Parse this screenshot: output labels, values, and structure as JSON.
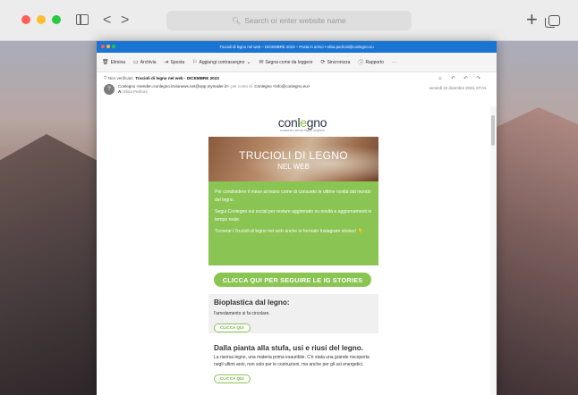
{
  "browser": {
    "address_placeholder": "Search or enter website name"
  },
  "outlook": {
    "window_title": "Trucioli di legno nel web – DICEMBRE 2023 – Posta in arrivo • elisa.pedroni@conlegno.eu",
    "toolbar": [
      {
        "icon": "trash-icon",
        "label": "Elimina"
      },
      {
        "icon": "archive-icon",
        "label": "Archivia"
      },
      {
        "icon": "move-icon",
        "label": "Sposta"
      },
      {
        "icon": "flag-icon",
        "label": "Aggiungi contrassegno"
      },
      {
        "icon": "envelope-icon",
        "label": "Segna come da leggere"
      },
      {
        "icon": "sync-icon",
        "label": "Sincronizza"
      },
      {
        "icon": "info-icon",
        "label": "Rapporto"
      }
    ],
    "toolbar_more": "···",
    "header": {
      "unverified_label": "Non verificato",
      "subject": "Trucioli di legno nel web - DICEMBRE 2023",
      "avatar_letter": "?",
      "sender": "Conlegno <sender=conlegno.invionews.net@opp.mymailer.it>",
      "on_behalf": "per conto di",
      "sender_alias": "Conlegno <info@conlegno.eu>",
      "to_label": "A:",
      "recipient": "Elisa Pedroni",
      "date": "venerdì 22 dicembre 2023, 07:04",
      "actions": "☺ ↶ ↶ ↷"
    }
  },
  "newsletter": {
    "logo_main": "conl",
    "logo_o": "e",
    "logo_rest": "gno",
    "logo_sub": "consorzio servizi legno sughero",
    "hero_line1": "TRUCIOLI DI LEGNO",
    "hero_line2": "NEL WEB",
    "intro_p1": "Per condividere il mese arrivano come di consueto le ultime novità dal mondo del legno.",
    "intro_p2": "Segui Conlegno sui social per restare aggiornato su novità e aggiornamenti in tempo reale.",
    "intro_p3": "Troverai i Trucioli di legno nel web anche in formato Instagram stories!",
    "intro_emoji": "👇",
    "cta_ig": "CLICCA QUI PER SEGUIRE LE IG STORIES",
    "article1_title": "Bioplastica dal legno:",
    "article1_text": "l'arredamento si fa circolare.",
    "article1_cta": "CLICCA QUI",
    "article2_title": "Dalla pianta alla stufa, usi e riusi del legno.",
    "article2_text": "La risorsa legno, una materia prima esauribile. C'è stata una grande riscoperta negli ultimi anni, non solo per le costruzioni, ma anche per gli usi energetici.",
    "article2_cta": "CLICCA QUI"
  }
}
